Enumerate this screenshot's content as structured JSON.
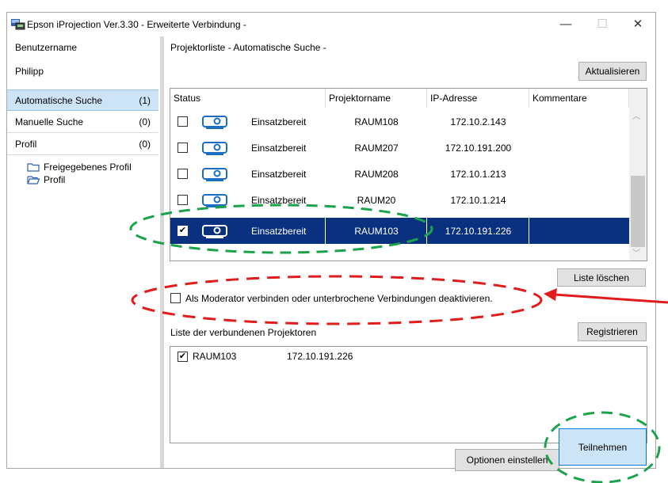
{
  "window": {
    "title": "Epson iProjection Ver.3.30 - Erweiterte Verbindung -",
    "minimize_label": "—",
    "maximize_label": "☐",
    "close_label": "✕"
  },
  "user": {
    "label": "Benutzername",
    "name": "Philipp"
  },
  "nav": {
    "items": [
      {
        "label": "Automatische Suche",
        "count": "(1)"
      },
      {
        "label": "Manuelle Suche",
        "count": "(0)"
      },
      {
        "label": "Profil",
        "count": "(0)"
      }
    ]
  },
  "tree": {
    "items": [
      {
        "label": "Freigegebenes Profil"
      },
      {
        "label": "Profil"
      }
    ]
  },
  "main": {
    "list_title": "Projektorliste - Automatische Suche -",
    "refresh_label": "Aktualisieren",
    "columns": [
      "Status",
      "Projektorname",
      "IP-Adresse",
      "Kommentare"
    ],
    "rows": [
      {
        "checked": false,
        "status": "Einsatzbereit",
        "name": "RAUM108",
        "ip": "172.10.2.143",
        "comment": ""
      },
      {
        "checked": false,
        "status": "Einsatzbereit",
        "name": "RAUM207",
        "ip": "172.10.191.200",
        "comment": ""
      },
      {
        "checked": false,
        "status": "Einsatzbereit",
        "name": "RAUM208",
        "ip": "172.10.1.213",
        "comment": ""
      },
      {
        "checked": false,
        "status": "Einsatzbereit",
        "name": "RAUM20",
        "ip": "172.10.1.214",
        "comment": ""
      },
      {
        "checked": true,
        "status": "Einsatzbereit",
        "name": "RAUM103",
        "ip": "172.10.191.226",
        "comment": ""
      }
    ],
    "clear_list_label": "Liste löschen",
    "moderator_checkbox_label": "Als Moderator verbinden oder unterbrochene Verbindungen deaktivieren.",
    "moderator_checked": false,
    "connected_title": "Liste der verbundenen Projektoren",
    "register_label": "Registrieren",
    "connected": [
      {
        "checked": true,
        "name": "RAUM103",
        "ip": "172.10.191.226"
      }
    ],
    "options_label": "Optionen einstellen",
    "join_label": "Teilnehmen"
  },
  "colors": {
    "selection": "#0a3180",
    "accent": "#0078d7",
    "annotation_green": "#1aa34a",
    "annotation_red": "#e21b1b"
  }
}
